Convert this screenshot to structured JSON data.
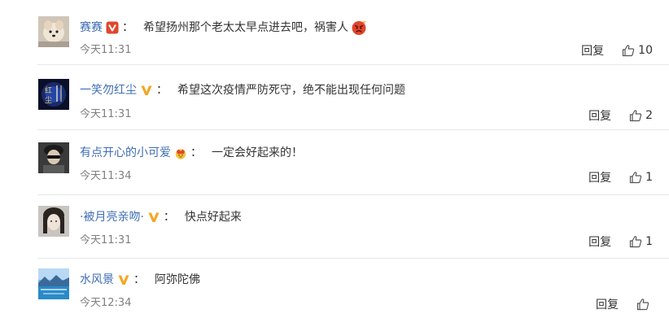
{
  "comments": [
    {
      "user": "赛赛",
      "badge": "vip-red-icon",
      "text": "希望扬州那个老太太早点进去吧，祸害人",
      "emoji": "angry-face-icon",
      "time": "今天11:31",
      "reply_label": "回复",
      "likes": "10"
    },
    {
      "user": "一笑勿红尘",
      "badge": "v-gold-icon",
      "text": "希望这次疫情严防死守，绝不能出现任何问题",
      "emoji": "",
      "time": "今天11:31",
      "reply_label": "回复",
      "likes": "2"
    },
    {
      "user": "有点开心的小可爱",
      "badge": "crown-icon",
      "text": "一定会好起来的！",
      "emoji": "",
      "time": "今天11:34",
      "reply_label": "回复",
      "likes": "1"
    },
    {
      "user": "·被月亮亲吻·",
      "badge": "v-gold-icon",
      "text": "快点好起来",
      "emoji": "",
      "time": "今天11:31",
      "reply_label": "回复",
      "likes": "1"
    },
    {
      "user": "水风景",
      "badge": "v-gold-icon",
      "text": "阿弥陀佛",
      "emoji": "",
      "time": "今天12:34",
      "reply_label": "回复",
      "likes": ""
    }
  ],
  "colors": {
    "username": "#3d6eb5",
    "time": "#808080",
    "divider": "#e6e6e6",
    "vip_red": "#e0462c",
    "v_gold": "#f5a623"
  }
}
